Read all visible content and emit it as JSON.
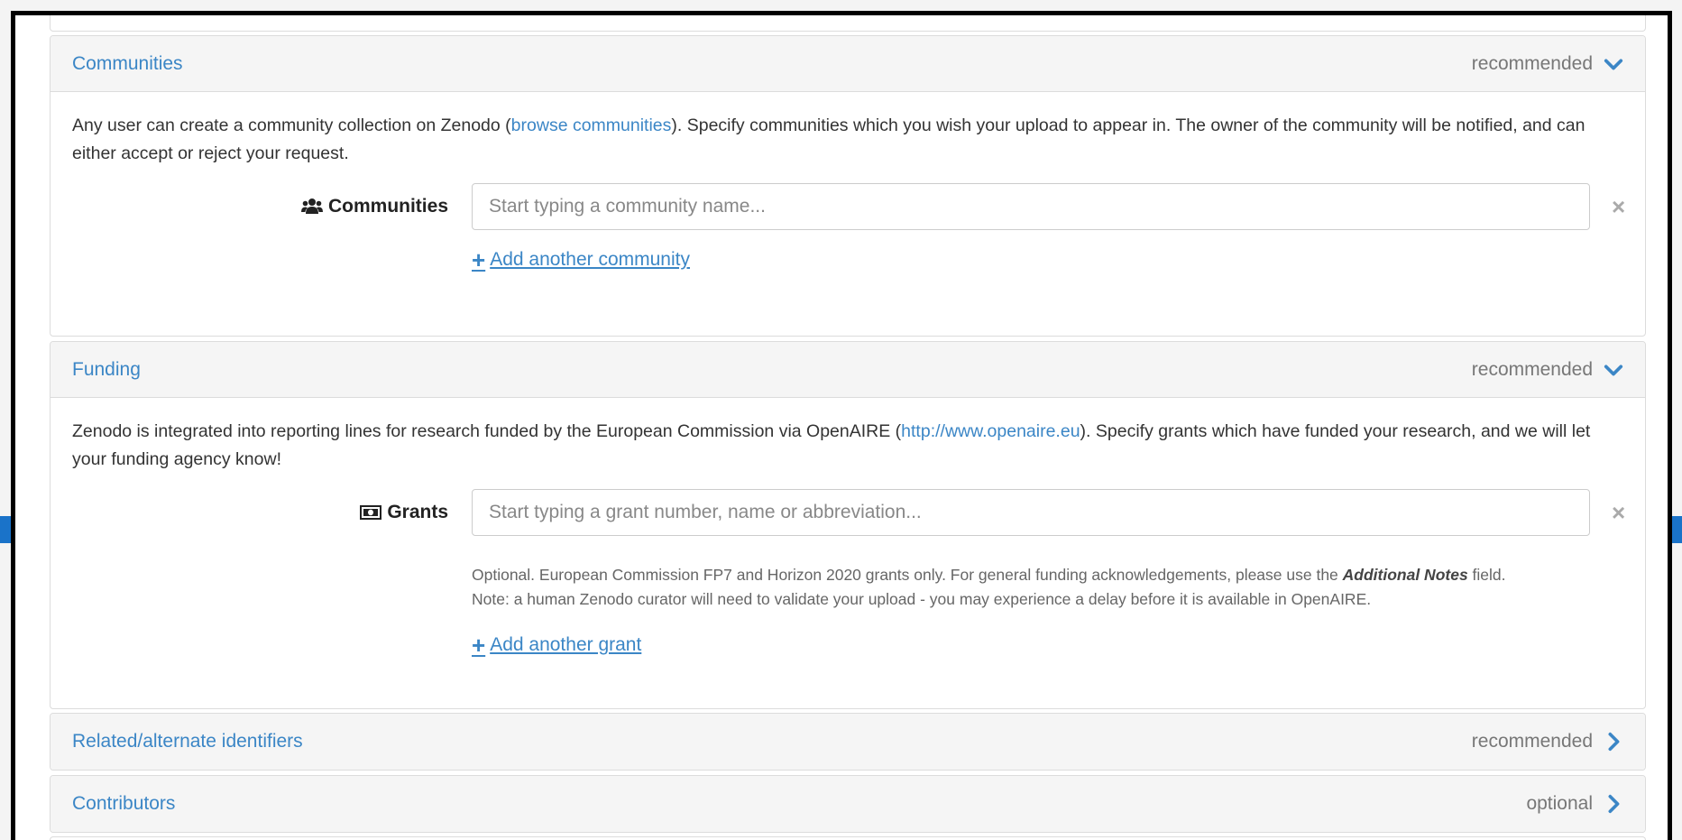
{
  "sections": {
    "communities": {
      "title": "Communities",
      "status": "recommended",
      "desc_before": "Any user can create a community collection on Zenodo (",
      "desc_link": "browse communities",
      "desc_after": "). Specify communities which you wish your upload to appear in. The owner of the community will be notified, and can either accept or reject your request.",
      "field_label": "Communities",
      "field_icon": "users-icon",
      "placeholder": "Start typing a community name...",
      "remove_symbol": "×",
      "add_label": "Add another community"
    },
    "funding": {
      "title": "Funding",
      "status": "recommended",
      "desc_before": "Zenodo is integrated into reporting lines for research funded by the European Commission via OpenAIRE (",
      "desc_link": "http://www.openaire.eu",
      "desc_after": "). Specify grants which have funded your research, and we will let your funding agency know!",
      "field_label": "Grants",
      "field_icon": "money-icon",
      "placeholder": "Start typing a grant number, name or abbreviation...",
      "remove_symbol": "×",
      "help_before": "Optional. European Commission FP7 and Horizon 2020 grants only. For general funding acknowledgements, please use the ",
      "help_emph": "Additional Notes",
      "help_after": " field.",
      "help_line2": "Note: a human Zenodo curator will need to validate your upload - you may experience a delay before it is available in OpenAIRE.",
      "add_label": "Add another grant"
    },
    "related": {
      "title": "Related/alternate identifiers",
      "status": "recommended"
    },
    "contributors": {
      "title": "Contributors",
      "status": "optional"
    }
  },
  "colors": {
    "link": "#3b86c6",
    "heading_bg": "#f5f5f5",
    "border": "#dcdcdc"
  }
}
